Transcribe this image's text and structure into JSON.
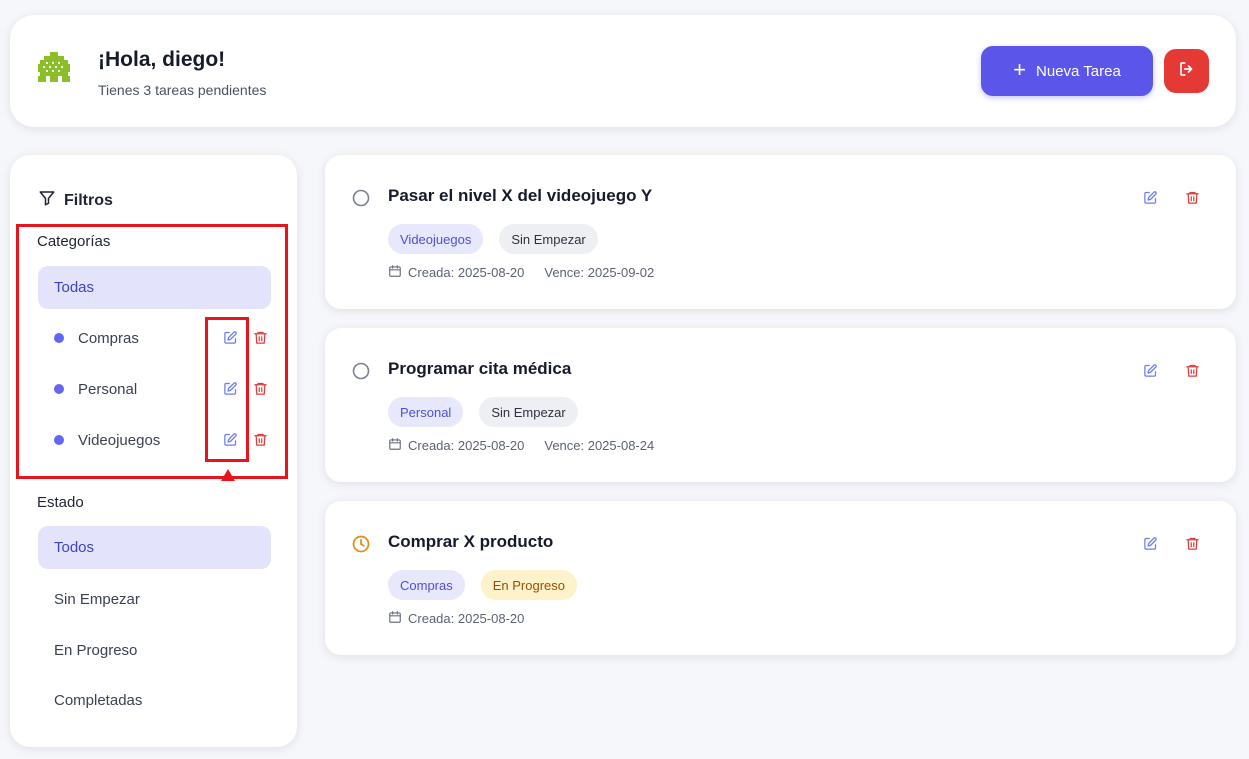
{
  "header": {
    "greeting": "¡Hola, diego!",
    "subtitle": "Tienes 3 tareas pendientes",
    "new_task_label": "Nueva Tarea",
    "avatar_icon": "pixel-avatar-icon",
    "logout_icon": "logout-icon"
  },
  "sidebar": {
    "title": "Filtros",
    "filter_icon": "funnel-icon",
    "categories_label": "Categorías",
    "categories_all": "Todas",
    "categories": [
      {
        "label": "Compras",
        "color": "#6366f1"
      },
      {
        "label": "Personal",
        "color": "#6366f1"
      },
      {
        "label": "Videojuegos",
        "color": "#6366f1"
      }
    ],
    "status_label": "Estado",
    "status_items": [
      "Todos",
      "Sin Empezar",
      "En Progreso",
      "Completadas"
    ]
  },
  "tasks": [
    {
      "title": "Pasar el nivel X del videojuego Y",
      "category": "Videojuegos",
      "status": "Sin Empezar",
      "status_icon": "circle-icon",
      "created": "Creada: 2025-08-20",
      "due": "Vence: 2025-09-02"
    },
    {
      "title": "Programar cita médica",
      "category": "Personal",
      "status": "Sin Empezar",
      "status_icon": "circle-icon",
      "created": "Creada: 2025-08-20",
      "due": "Vence: 2025-08-24"
    },
    {
      "title": "Comprar X producto",
      "category": "Compras",
      "status": "En Progreso",
      "status_icon": "clock-icon",
      "created": "Creada: 2025-08-20"
    }
  ],
  "colors": {
    "accent": "#5b55ea",
    "danger": "#e53935",
    "annotation": "#e8141b",
    "edit_icon": "#6a7cf0",
    "delete_icon": "#e23b3b",
    "in_progress": "#e08a18"
  }
}
